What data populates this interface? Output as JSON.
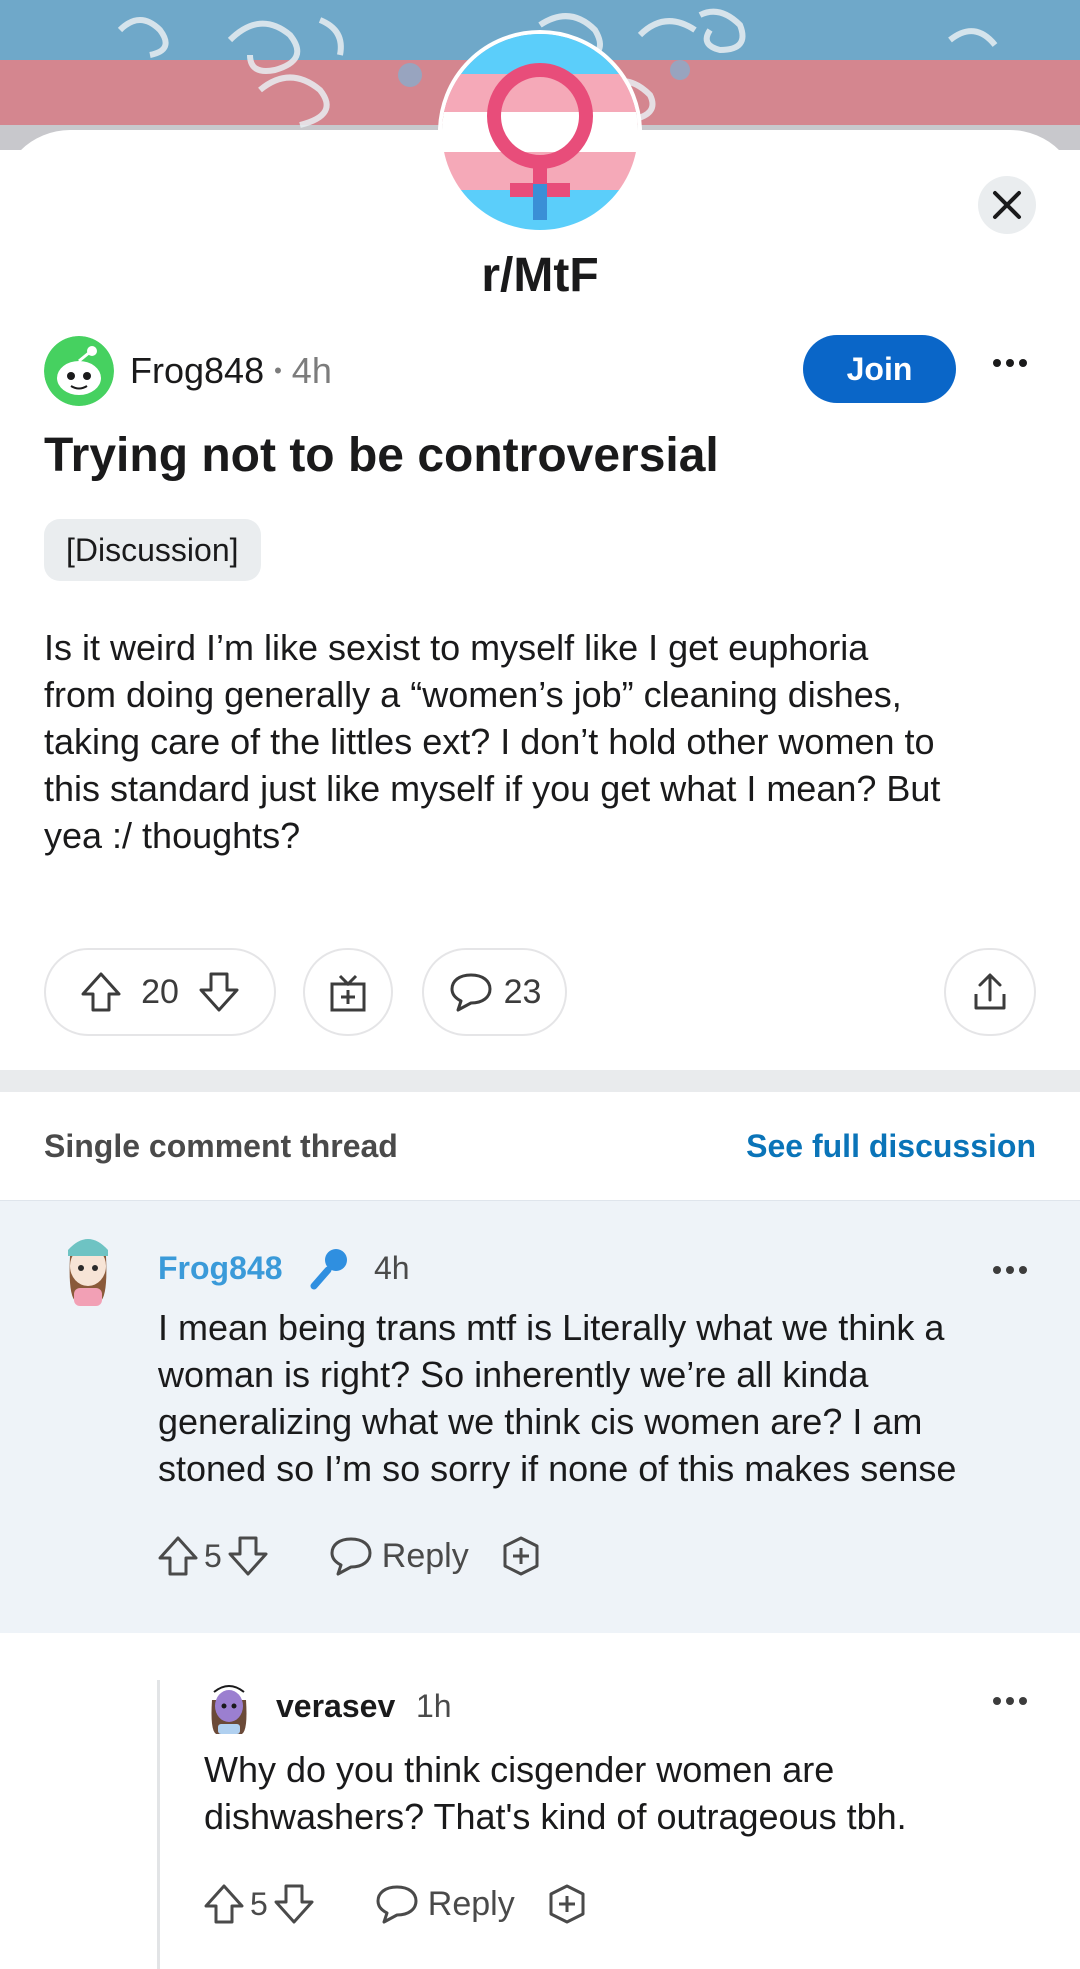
{
  "subreddit": {
    "name": "r/MtF"
  },
  "post": {
    "author": "Frog848",
    "separator": "•",
    "time": "4h",
    "join_label": "Join",
    "title": "Trying not to be controversial",
    "flair": "[Discussion]",
    "body_lines": [
      "Is it weird I’m like sexist to myself like I get euphoria",
      "from doing generally a “women’s job” cleaning dishes,",
      "taking care of the littles ext? I don’t hold other women to",
      "this standard just like myself if you get what I mean? But",
      "yea :/ thoughts?"
    ],
    "votes": "20",
    "comments": "23"
  },
  "thread": {
    "label": "Single comment thread",
    "see_full": "See full discussion"
  },
  "comments": [
    {
      "author": "Frog848",
      "time": "4h",
      "body_lines": [
        "I mean being trans mtf is Literally what we think a",
        "woman is right? So inherently we’re all kinda",
        "generalizing what we think cis women are? I am",
        "stoned so I’m so sorry if none of this makes sense"
      ],
      "votes": "5",
      "reply_label": "Reply"
    },
    {
      "author": "verasev",
      "time": "1h",
      "body_lines": [
        "Why do you think cisgender women are",
        "dishwashers? That's kind of outrageous tbh."
      ],
      "votes": "5",
      "reply_label": "Reply"
    }
  ],
  "colors": {
    "join_blue": "#0a66c8",
    "link_blue": "#0a74b8",
    "op_name": "#3a9ad9",
    "highlight_bg": "#eef3f8",
    "trans_blue": "#5bcefa",
    "trans_pink": "#f5a9b8"
  },
  "icons": [
    "close-icon",
    "more-icon",
    "upvote-icon",
    "downvote-icon",
    "award-icon",
    "comment-icon",
    "share-icon",
    "microphone-icon",
    "reply-icon"
  ]
}
